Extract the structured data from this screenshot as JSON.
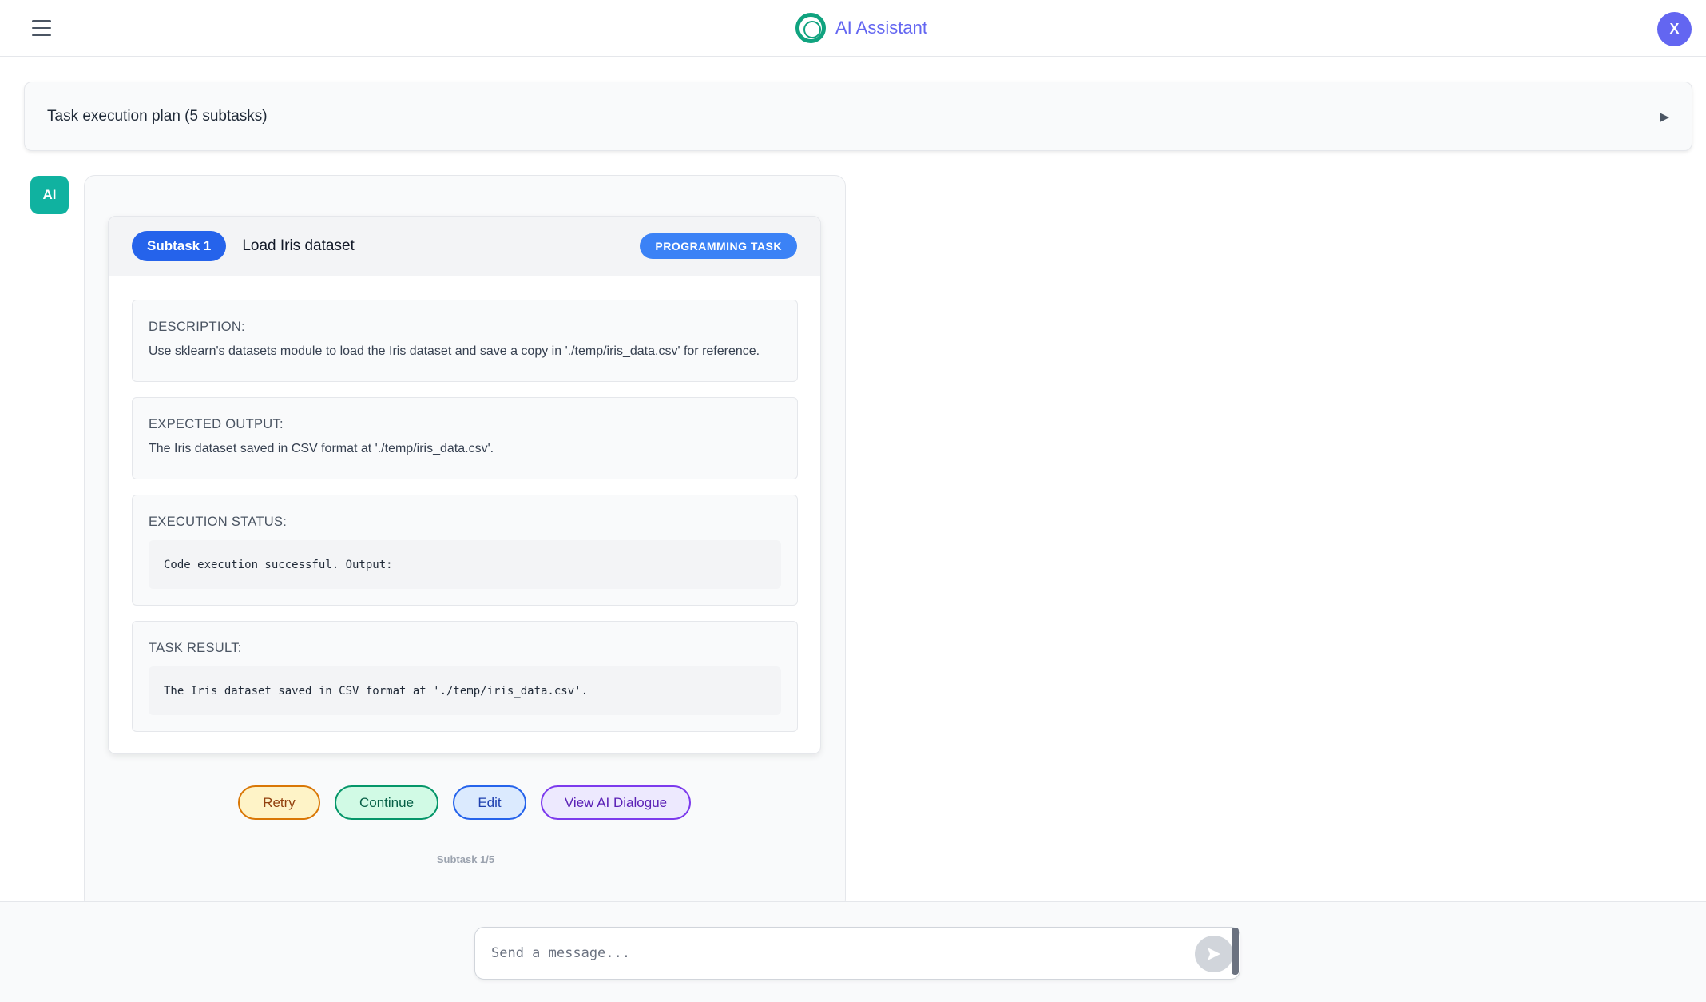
{
  "header": {
    "menu_icon": "hamburger-menu-icon",
    "app_title": "AI Assistant",
    "logo_icon": "ring-logo-icon",
    "user_avatar": "X"
  },
  "plan": {
    "title": "Task execution plan (5 subtasks)",
    "toggle_glyph": "▶"
  },
  "message": {
    "avatar": "AI",
    "subtask": {
      "pill": "Subtask 1",
      "title": "Load Iris dataset",
      "type_badge": "PROGRAMMING TASK",
      "description_label": "DESCRIPTION:",
      "description": "Use sklearn's datasets module to load the Iris dataset and save a copy in './temp/iris_data.csv' for reference.",
      "expected_label": "EXPECTED OUTPUT:",
      "expected": "The Iris dataset saved in CSV format at './temp/iris_data.csv'.",
      "status_label": "EXECUTION STATUS:",
      "status": "Code execution successful. Output:",
      "result_label": "TASK RESULT:",
      "result": "The Iris dataset saved in CSV format at './temp/iris_data.csv'."
    },
    "actions": {
      "retry": "Retry",
      "continue": "Continue",
      "edit": "Edit",
      "view_dialogue": "View AI Dialogue"
    },
    "progress": "Subtask 1/5"
  },
  "input": {
    "placeholder": "Send a message...",
    "value": ""
  },
  "colors": {
    "accent": "#6366f1",
    "brand_green": "#10a37f",
    "subtask_blue": "#2563eb"
  }
}
